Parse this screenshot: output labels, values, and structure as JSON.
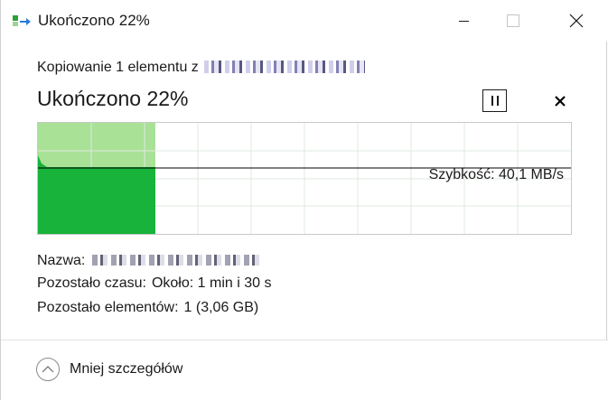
{
  "window": {
    "title": "Ukończono 22%",
    "icon": "copy-transfer-icon"
  },
  "transfer": {
    "subtitle_prefix": "Kopiowanie 1 elementu z",
    "headline": "Ukończono 22%",
    "progress_fraction": 0.22,
    "speed_label": "Szybkość: 40,1 MB/s",
    "current_speed_fraction": 0.59
  },
  "details": {
    "name_label": "Nazwa:",
    "time_label": "Pozostało czasu:",
    "time_value": "Około: 1 min i 30 s",
    "items_label": "Pozostało elementów:",
    "items_value": "1 (3,06 GB)"
  },
  "footer": {
    "toggle_label": "Mniej szczegółów"
  },
  "colors": {
    "progress_fill_light": "#a9e197",
    "speed_fill": "#17b33a",
    "grid_line": "#dfe9df",
    "speed_line": "#000000"
  }
}
